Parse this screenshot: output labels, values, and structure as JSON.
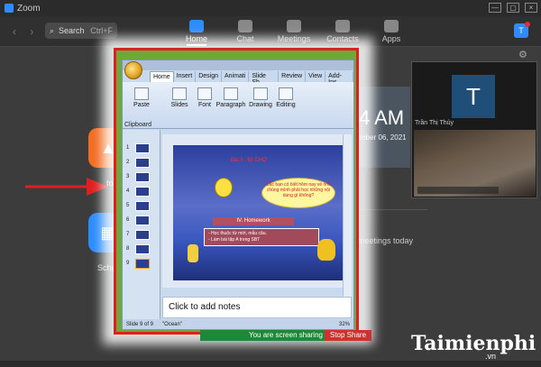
{
  "window": {
    "title": "Zoom",
    "controls": [
      "—",
      "▢",
      "×"
    ]
  },
  "search": {
    "label": "Search",
    "shortcut": "Ctrl+F"
  },
  "nav_tabs": [
    {
      "label": "Home",
      "active": true
    },
    {
      "label": "Chat",
      "active": false
    },
    {
      "label": "Meetings",
      "active": false
    },
    {
      "label": "Contacts",
      "active": false
    },
    {
      "label": "Apps",
      "active": false
    }
  ],
  "home": {
    "clock": "4 AM",
    "date": "tober 06, 2021",
    "upcoming": "meetings today",
    "share_label_partial": "to",
    "schedule_label_partial": "Sche"
  },
  "video": {
    "initial": "T",
    "participant_name": "Trần Thị Thủy"
  },
  "share_bar": {
    "status": "You are screen sharing",
    "stop": "Stop Share"
  },
  "ppt": {
    "ribbon_tabs": [
      "Home",
      "Insert",
      "Design",
      "Animati",
      "Slide Sh",
      "Review",
      "View",
      "Add-Ins"
    ],
    "groups": [
      "Paste",
      "Slides",
      "Font",
      "Paragraph",
      "Drawing",
      "Editing"
    ],
    "clipboard": "Clipboard",
    "slide_numbers": [
      "1",
      "2",
      "3",
      "4",
      "5",
      "6",
      "7",
      "8",
      "9"
    ],
    "slide": {
      "title": "Bài 5 : ĐI CHỢ",
      "cloud": "Các bạn có biết hôm nay về nhà chúng mình phải học những nội dung gì không?",
      "homework": "IV. Homework",
      "tasks": [
        "- Học thuộc từ mới, mẫu câu.",
        "- Làm bài tập  A trong SBT"
      ]
    },
    "notes_placeholder": "Click to add notes",
    "status_slide": "Slide 9 of 9",
    "theme": "\"Ocean\"",
    "zoom": "32%"
  },
  "watermark": {
    "brand": "Taimienphi",
    "suffix": ".vn"
  }
}
